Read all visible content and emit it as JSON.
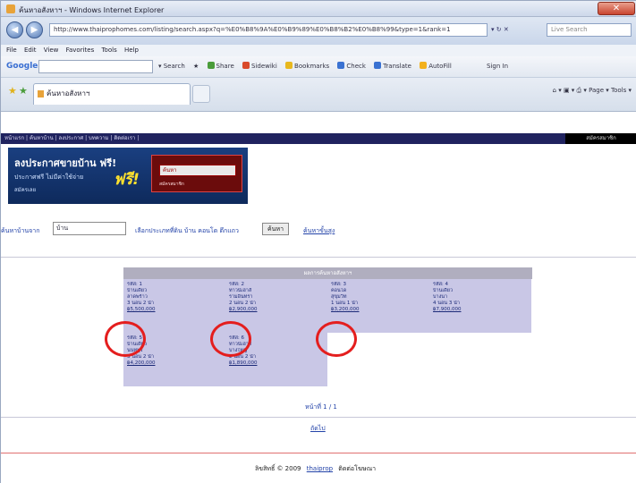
{
  "window": {
    "title": "ค้นหาอสังหาฯ - Windows Internet Explorer",
    "close_glyph": "✕"
  },
  "nav": {
    "back": "◀",
    "forward": "▶"
  },
  "address": {
    "url": "http://www.thaiprophomes.com/listing/search.aspx?q=%E0%B8%9A%E0%B9%89%E0%B8%B2%E0%B8%99&type=1&rank=1",
    "go": "▾ ↻ ✕",
    "live_search_placeholder": "Live Search"
  },
  "menu": [
    "File",
    "Edit",
    "View",
    "Favorites",
    "Tools",
    "Help"
  ],
  "google": {
    "logo": "Google",
    "items": [
      "▾ Search",
      "★",
      "Share",
      "Sidewiki",
      "Bookmarks",
      "Check",
      "Translate",
      "AutoFill"
    ],
    "sign_in": "Sign In"
  },
  "tabs": {
    "active_label": "ค้นหาอสังหาฯ",
    "tools": "⌂ ▾ ▣ ▾ ⎙ ▾ Page ▾ Tools ▾"
  },
  "site": {
    "nav_text": "หน้าแรก | ค้นหาบ้าน | ลงประกาศ | บทความ | ติดต่อเรา |",
    "nav_right": "สมัครสมาชิก",
    "banner_title": "ลงประกาศขายบ้าน ฟรี!",
    "banner_sub": "ประกาศฟรี ไม่มีค่าใช้จ่าย",
    "banner_small": "สมัครเลย",
    "banner_free": "ฟรี!",
    "banner_box": "ค้นหา ",
    "banner_box_small": "สมัครสมาชิก"
  },
  "search": {
    "label": "ค้นหาบ้านจาก",
    "value": "บ้าน",
    "options": "เลือกประเภทที่ดิน  บ้าน  คอนโด  ตึกแถว",
    "button": "ค้นหา",
    "advanced": "ค้นหาขั้นสูง"
  },
  "results": {
    "header": "ผลการค้นหาอสังหาฯ",
    "cells": [
      [
        "รหัส: 1",
        "บ้านเดี่ยว",
        "ลาดพร้าว",
        "3 นอน 2 น้ำ",
        "฿5,500,000"
      ],
      [
        "รหัส: 2",
        "ทาวน์เฮาส์",
        "รามอินทรา",
        "2 นอน 2 น้ำ",
        "฿2,900,000"
      ],
      [
        "รหัส: 3",
        "คอนโด",
        "สุขุมวิท",
        "1 นอน 1 น้ำ",
        "฿3,200,000"
      ],
      [
        "รหัส: 4",
        "บ้านเดี่ยว",
        "บางนา",
        "4 นอน 3 น้ำ",
        "฿7,900,000"
      ],
      [
        "รหัส: 5",
        "บ้านเดี่ยว",
        "นนทบุรี",
        "3 นอน 2 น้ำ",
        "฿4,200,000"
      ],
      [
        "รหัส: 6",
        "ทาวน์เฮาส์",
        "บางใหญ่",
        "2 นอน 2 น้ำ",
        "฿1,890,000"
      ]
    ]
  },
  "pagination": "หน้าที่ 1 / 1",
  "next": "ถัดไป",
  "footer": {
    "left": "ลิขสิทธิ์ © 2009",
    "middle": "thaiprop",
    "right": "ติดต่อโฆษณา"
  },
  "colors": {
    "highlight": "#e41e1e",
    "cell": "#c9c7e6",
    "nav": "#20235f"
  }
}
